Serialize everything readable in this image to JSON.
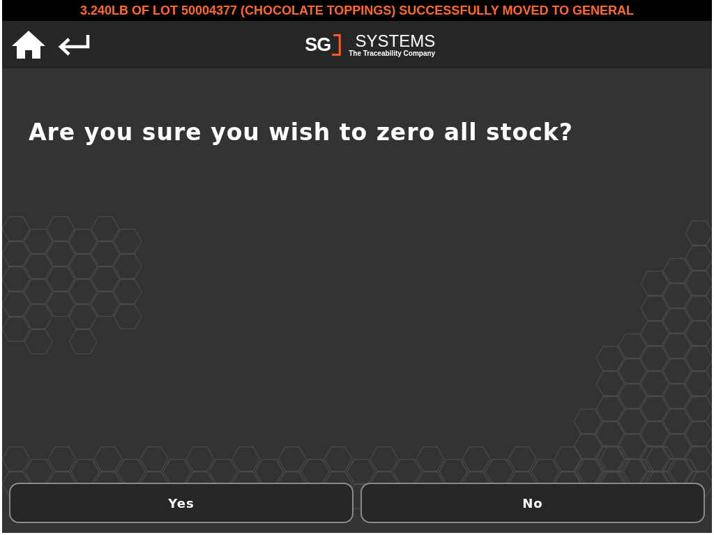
{
  "banner": {
    "message": "3.240LB OF LOT 50004377 (CHOCOLATE TOPPINGS) SUCCESSFULLY MOVED TO GENERAL"
  },
  "header": {
    "logo": {
      "mark": "SG",
      "name": "SYSTEMS",
      "tagline": "The Traceability Company"
    }
  },
  "dialog": {
    "question": "Are you sure you wish to zero all stock?"
  },
  "buttons": [
    {
      "label": "Yes"
    },
    {
      "label": "No"
    }
  ]
}
